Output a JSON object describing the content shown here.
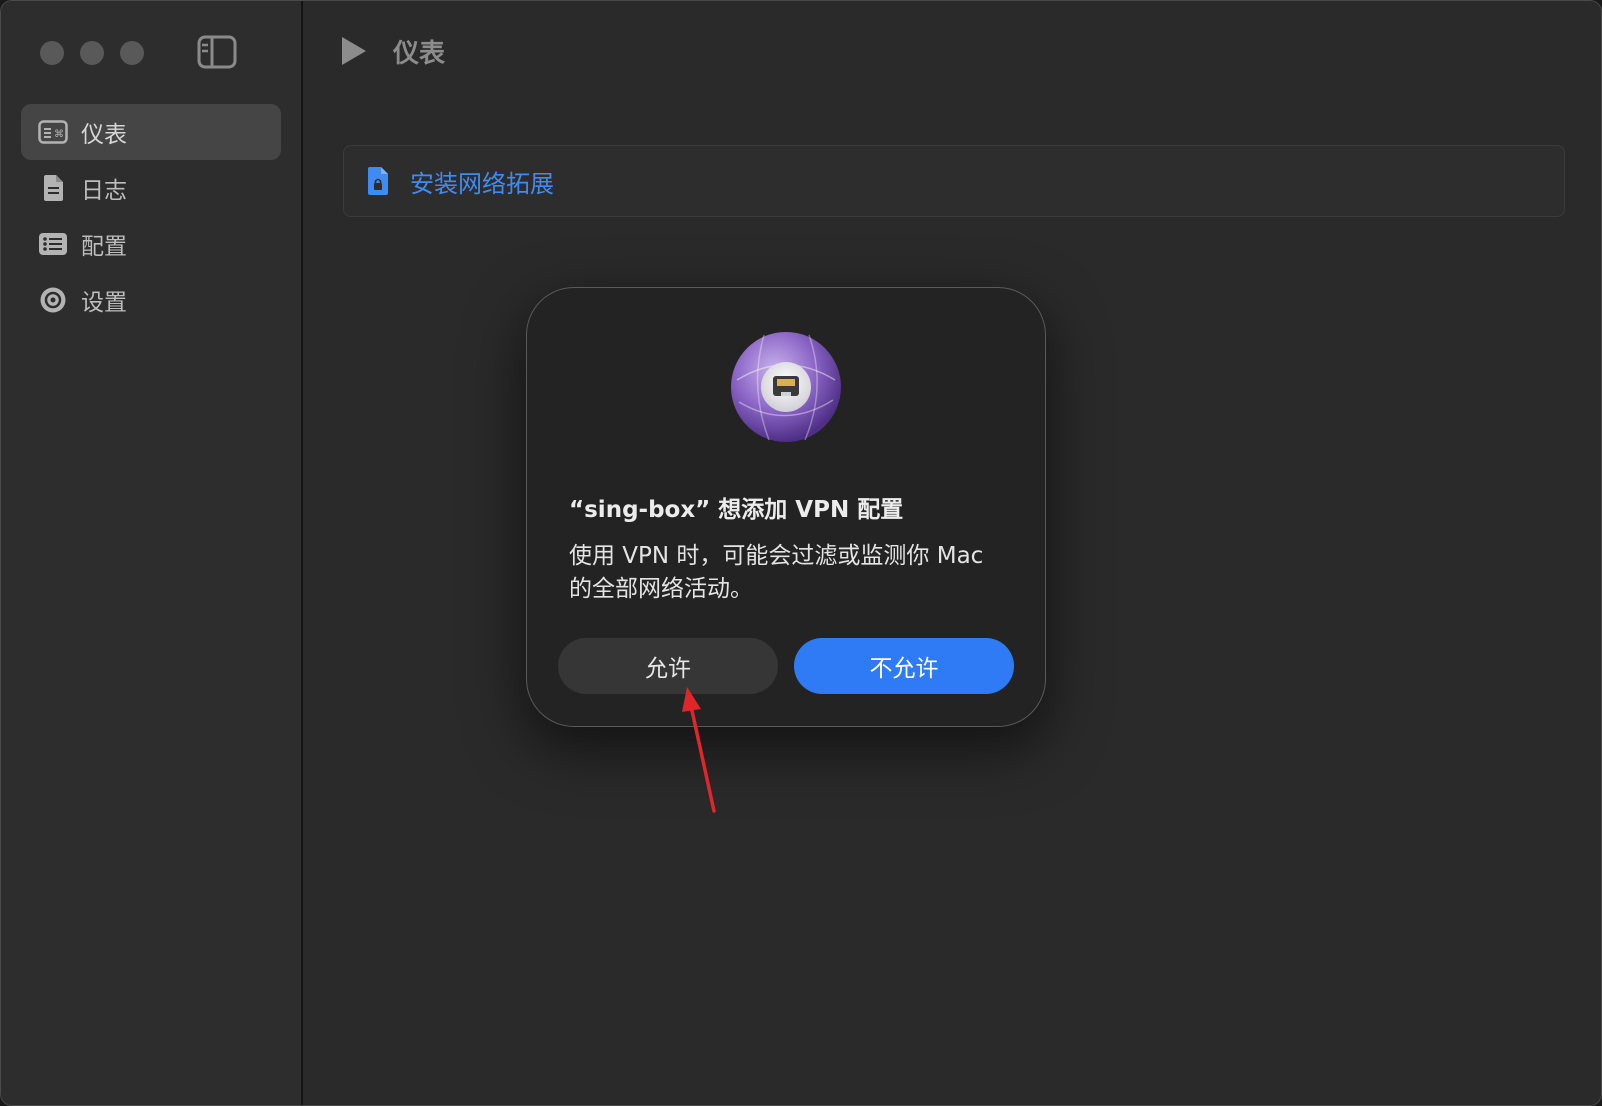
{
  "toolbar": {
    "title": "仪表"
  },
  "sidebar": {
    "items": [
      {
        "label": "仪表",
        "icon": "dashboard-icon",
        "active": true
      },
      {
        "label": "日志",
        "icon": "document-icon",
        "active": false
      },
      {
        "label": "配置",
        "icon": "list-icon",
        "active": false
      },
      {
        "label": "设置",
        "icon": "gear-icon",
        "active": false
      }
    ]
  },
  "main": {
    "install_extension_label": "安装网络拓展"
  },
  "dialog": {
    "title": "“sing-box” 想添加 VPN 配置",
    "message": "使用 VPN 时，可能会过滤或监测你 Mac 的全部网络活动。",
    "allow_label": "允许",
    "deny_label": "不允许"
  },
  "colors": {
    "accent": "#2f7bf5",
    "link": "#3f8bf4",
    "annotation_arrow": "#e0262b"
  }
}
